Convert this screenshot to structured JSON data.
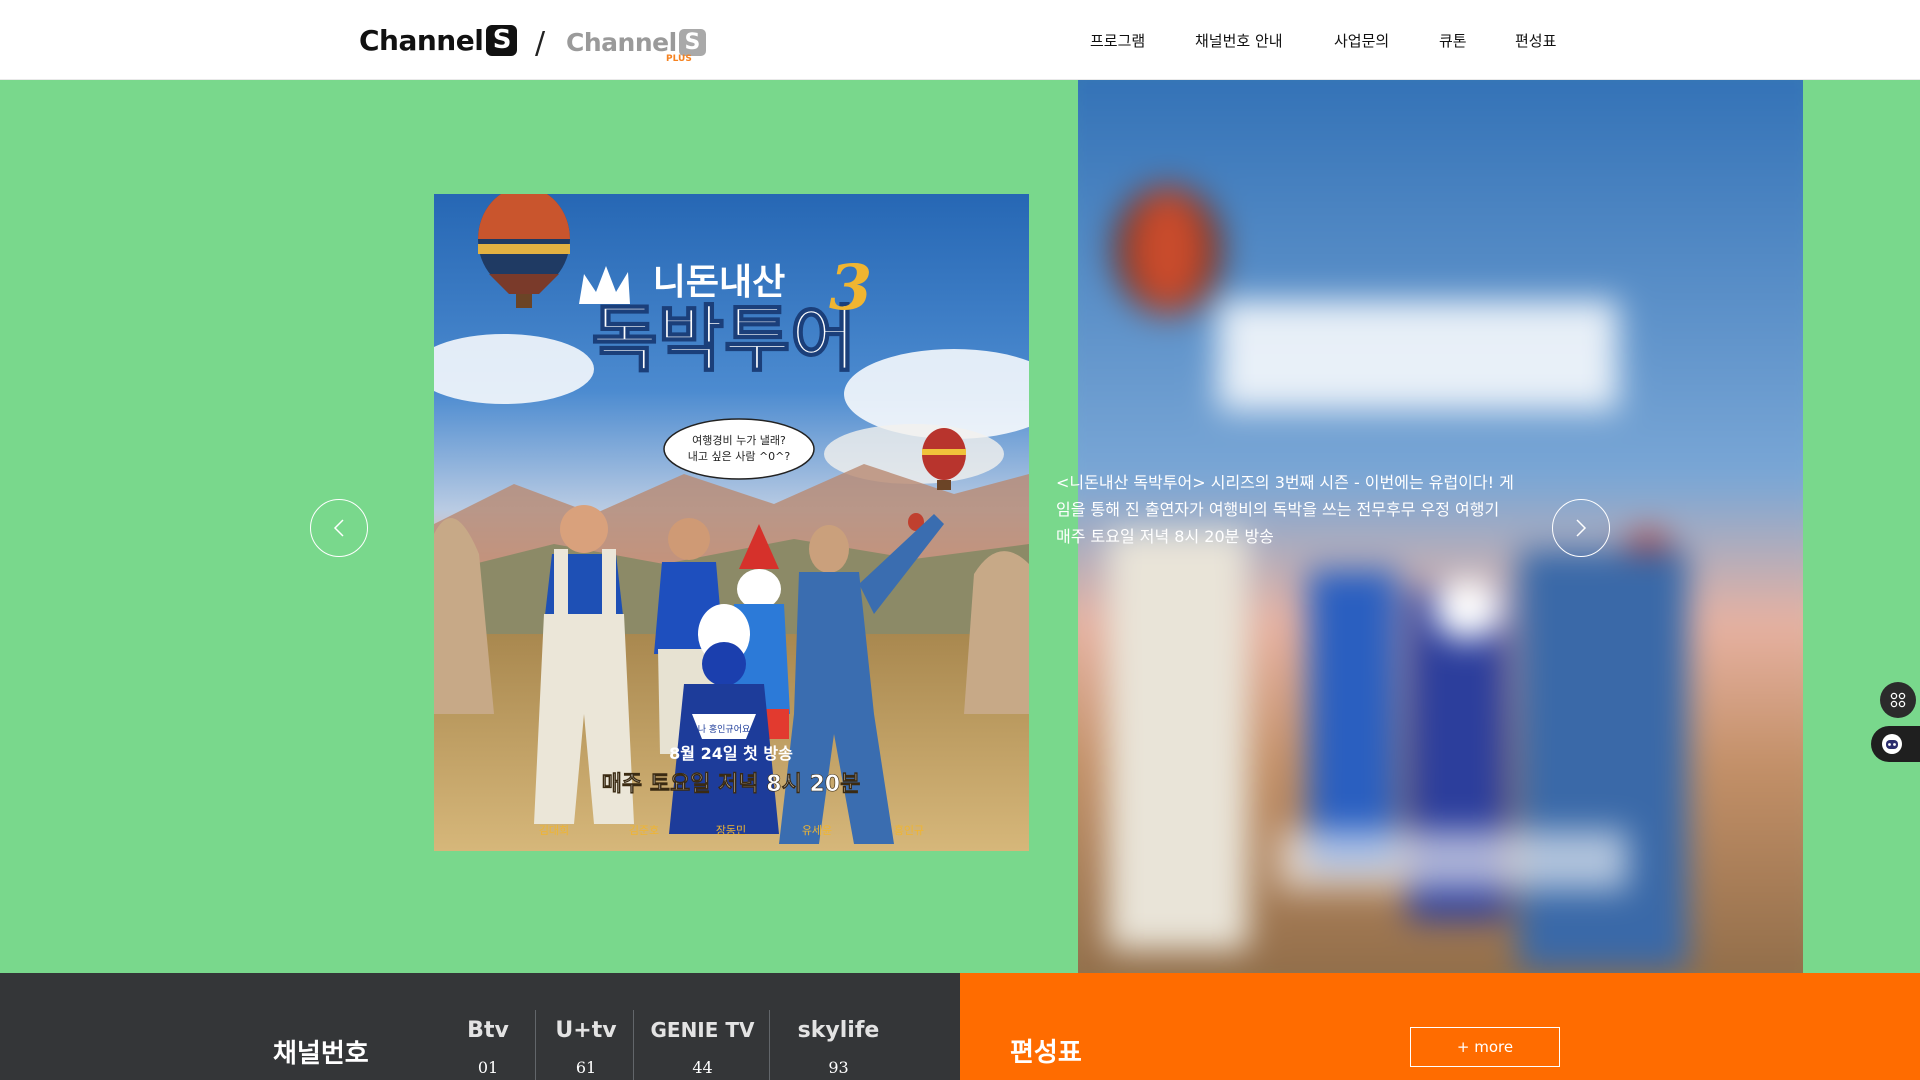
{
  "header": {
    "logo_main_text": "Channel",
    "logo_main_badge": "S",
    "logo_slash": "/",
    "logo_plus_text": "Channel",
    "logo_plus_badge": "S",
    "logo_plus_tag": "PLUS",
    "nav": [
      {
        "label": "프로그램"
      },
      {
        "label": "채널번호 안내"
      },
      {
        "label": "사업문의"
      },
      {
        "label": "큐톤"
      },
      {
        "label": "편성표"
      }
    ]
  },
  "hero": {
    "background_color": "#79d88c",
    "poster": {
      "title_top": "니돈내산",
      "title_main": "독박투어",
      "season_mark": "3",
      "speech_bubble_1": "여행경비 누가 낼래?",
      "speech_bubble_2": "내고 싶은 사람 ^0^?",
      "sign_text": "나 홍인규어요",
      "premiere": "8월 24일 첫 방송",
      "schedule": "매주 토요일 저녁 8시 20분",
      "cast": [
        "김대희",
        "김준호",
        "장동민",
        "유세윤",
        "홍인규"
      ]
    },
    "description_lines": [
      "<니돈내산 독박투어> 시리즈의 3번째 시즌 - 이번에는 유럽이다! 게",
      "임을 통해 진 출연자가 여행비의 독박을 쓰는 전무후무 우정 여행기",
      "매주 토요일 저녁 8시 20분 방송"
    ],
    "prev_icon": "chevron-left-icon",
    "next_icon": "chevron-right-icon"
  },
  "channels": {
    "title": "채널번호",
    "items": [
      {
        "provider": "Btv",
        "number": "01"
      },
      {
        "provider": "U+tv",
        "number": "61"
      },
      {
        "provider": "GENIE TV",
        "number": "44"
      },
      {
        "provider": "skylife",
        "number": "93"
      }
    ]
  },
  "schedule": {
    "title": "편성표",
    "more_label": "+ more",
    "accent_color": "#ff6c00"
  }
}
